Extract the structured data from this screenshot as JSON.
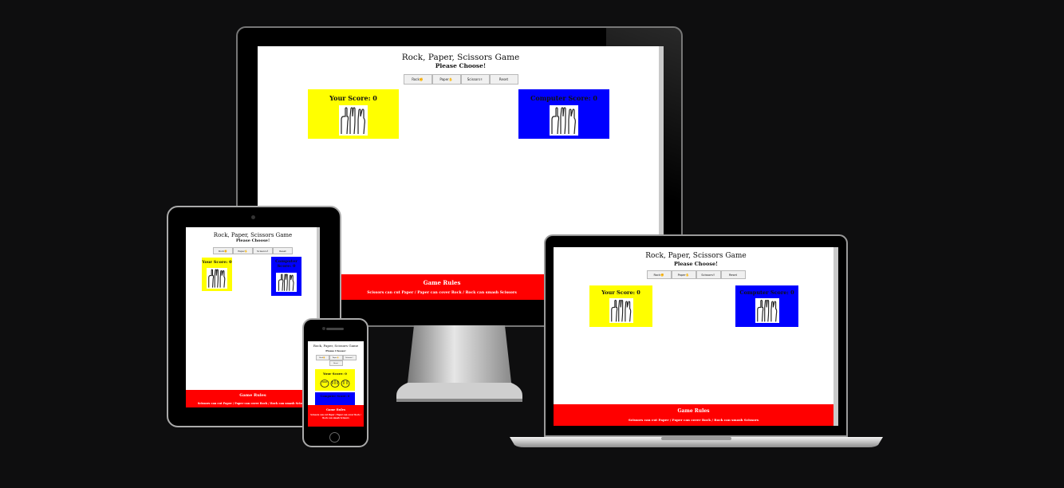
{
  "game": {
    "title": "Rock, Paper, Scissors Game",
    "subtitle": "Please Choose!",
    "buttons": [
      "Rock✊",
      "Paper✋",
      "Scissors✌",
      "Reset"
    ],
    "player_score": "Your Score: 0",
    "computer_score": "Computer Score: 0",
    "rules_title": "Game Rules",
    "rules_text": "Scissors can cut Paper / Paper can cover Rock / Rock can smash Scissors"
  },
  "colors": {
    "page_bg": "#0e0e0f",
    "player_panel": "#ffff00",
    "computer_panel": "#0000ff",
    "rules_bar": "#ff0000"
  },
  "icons": [
    "rock-hand-icon",
    "paper-hand-icon",
    "scissors-hand-icon"
  ]
}
